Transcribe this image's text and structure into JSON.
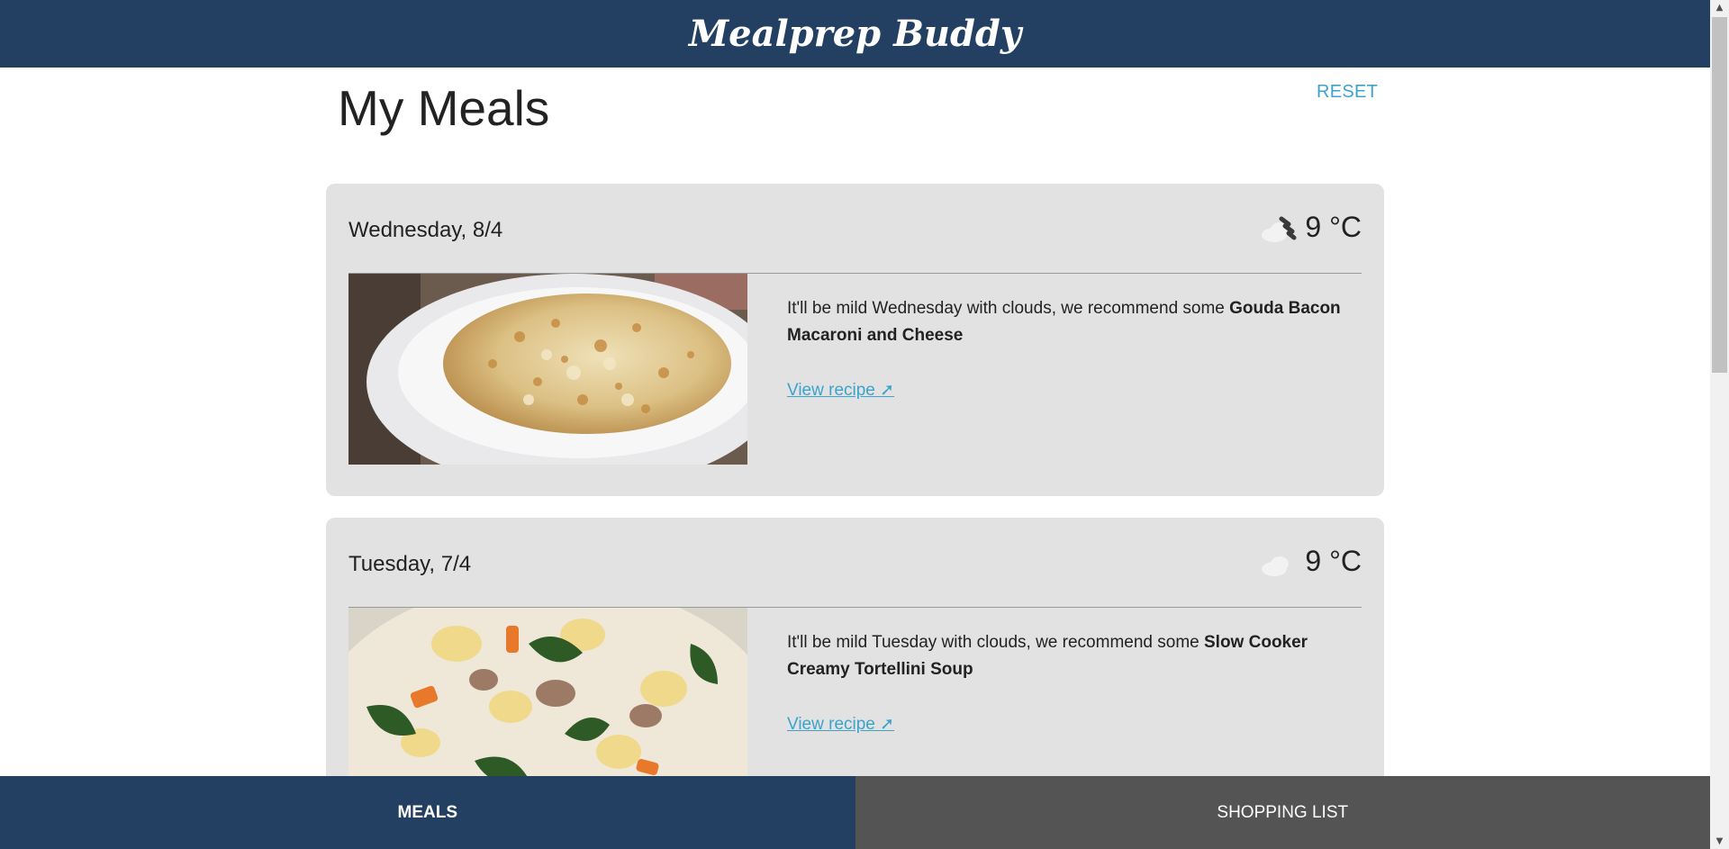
{
  "app": {
    "title": "Mealprep Buddy"
  },
  "page": {
    "title": "My Meals",
    "reset_label": "RESET"
  },
  "meals": [
    {
      "date": "Wednesday, 8/4",
      "temperature": "9 °C",
      "weather_icon": "cloud-rain-icon",
      "text_prefix": "It'll be mild Wednesday with clouds, we recommend some ",
      "dish": "Gouda Bacon Macaroni and Cheese",
      "link_label": "View recipe ➚"
    },
    {
      "date": "Tuesday, 7/4",
      "temperature": "9 °C",
      "weather_icon": "cloud-icon",
      "text_prefix": "It'll be mild Tuesday with clouds, we recommend some ",
      "dish": "Slow Cooker Creamy Tortellini Soup",
      "link_label": "View recipe ➚"
    }
  ],
  "nav": {
    "tabs": [
      {
        "label": "MEALS",
        "active": true
      },
      {
        "label": "SHOPPING LIST",
        "active": false
      }
    ]
  },
  "colors": {
    "header_bg": "#234063",
    "card_bg": "#e2e2e2",
    "link": "#3ba3cc",
    "inactive_tab": "#545454"
  }
}
